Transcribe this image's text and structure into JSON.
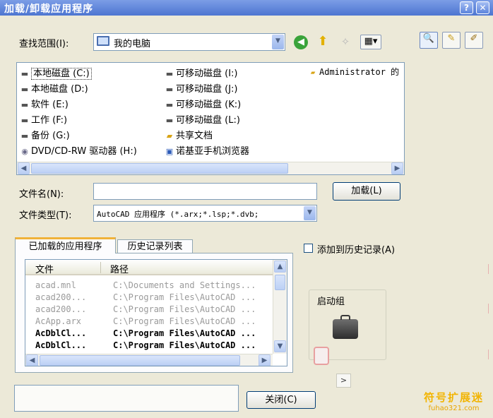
{
  "window": {
    "title": "加载/卸载应用程序",
    "help_label": "?",
    "close_label": "✕"
  },
  "lookin": {
    "label": "查找范围(I):",
    "value": "我的电脑"
  },
  "icons": {
    "back": "back-arrow-icon",
    "up": "up-folder-icon",
    "new_folder": "new-folder-icon",
    "views": "views-menu-icon",
    "search": "search-icon",
    "mark": "mark-icon",
    "edit": "edit-icon"
  },
  "files": {
    "col1": [
      {
        "name": "本地磁盘 (C:)",
        "icon": "drive-icon"
      },
      {
        "name": "本地磁盘 (D:)",
        "icon": "drive-icon"
      },
      {
        "name": "软件 (E:)",
        "icon": "drive-icon"
      },
      {
        "name": "工作 (F:)",
        "icon": "drive-icon"
      },
      {
        "name": "备份 (G:)",
        "icon": "drive-icon"
      },
      {
        "name": "DVD/CD-RW 驱动器 (H:)",
        "icon": "dvd-icon"
      }
    ],
    "col2": [
      {
        "name": "可移动磁盘 (I:)",
        "icon": "drive-icon"
      },
      {
        "name": "可移动磁盘 (J:)",
        "icon": "drive-icon"
      },
      {
        "name": "可移动磁盘 (K:)",
        "icon": "drive-icon"
      },
      {
        "name": "可移动磁盘 (L:)",
        "icon": "drive-icon"
      },
      {
        "name": "共享文档",
        "icon": "folder-icon"
      },
      {
        "name": "诺基亚手机浏览器",
        "icon": "app-icon"
      }
    ],
    "col3": [
      {
        "name": "Administrator 的",
        "icon": "folder-icon"
      }
    ]
  },
  "filename": {
    "label": "文件名(N):",
    "value": ""
  },
  "load_button": "加载(L)",
  "filetype": {
    "label": "文件类型(T):",
    "value": "AutoCAD 应用程序 (*.arx;*.lsp;*.dvb;"
  },
  "tabs": [
    "已加载的应用程序",
    "历史记录列表"
  ],
  "add_history": "添加到历史记录(A)",
  "apps_table": {
    "headers": [
      "文件",
      "路径"
    ],
    "rows": [
      {
        "file": "acad.mnl",
        "path": "C:\\Documents and Settings..."
      },
      {
        "file": "acad200...",
        "path": "C:\\Program Files\\AutoCAD ..."
      },
      {
        "file": "acad200...",
        "path": "C:\\Program Files\\AutoCAD ..."
      },
      {
        "file": "AcApp.arx",
        "path": "C:\\Program Files\\AutoCAD ..."
      },
      {
        "file": "AcDblCl...",
        "path": "C:\\Program Files\\AutoCAD ..."
      },
      {
        "file": "AcDblCl...",
        "path": "C:\\Program Files\\AutoCAD ..."
      }
    ]
  },
  "startup_group": "启动组",
  "close_button": "关闭(C)",
  "watermark": {
    "line1": "符号扩展迷",
    "line2": "fuhao321.com"
  }
}
